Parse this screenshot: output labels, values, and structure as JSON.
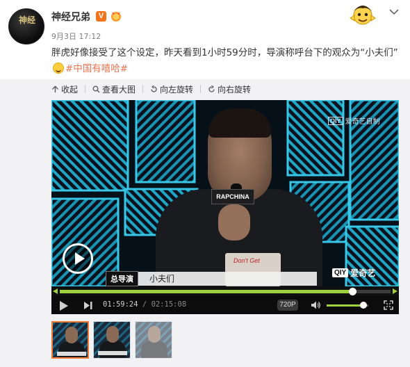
{
  "post": {
    "author_name": "神经兄弟",
    "avatar_text": "神经",
    "verified_badge": "V",
    "timestamp": "9月3日 17:12",
    "text_main": "胖虎好像接受了这个设定，昨天看到1小时59分时，导演称呼台下的观众为“小夫们”",
    "hashtag": "#中国有嘻哈#"
  },
  "toolbar": {
    "collapse": "收起",
    "view_large": "查看大图",
    "rotate_left": "向左旋转",
    "rotate_right": "向右旋转"
  },
  "video": {
    "watermark_top_logo": "QIY",
    "watermark_top_text": "爱奇艺自制",
    "watermark_br_logo": "QIY",
    "watermark_br_text": "爱奇艺",
    "mic_label": "RAPCHINA",
    "shirt_text": "Don't Get",
    "caption_tag": "总导演",
    "caption_text": "小夫们",
    "current_time": "01:59:24",
    "duration": "02:15:08",
    "quality": "720P",
    "progress_fraction": 0.884,
    "volume_fraction": 0.88
  },
  "thumbnails": [
    {
      "state": "active"
    },
    {
      "state": "normal"
    },
    {
      "state": "dim"
    }
  ],
  "colors": {
    "accent": "#eb7350",
    "progress": "#9fd13f",
    "thumb_active_border": "#f47b36"
  }
}
